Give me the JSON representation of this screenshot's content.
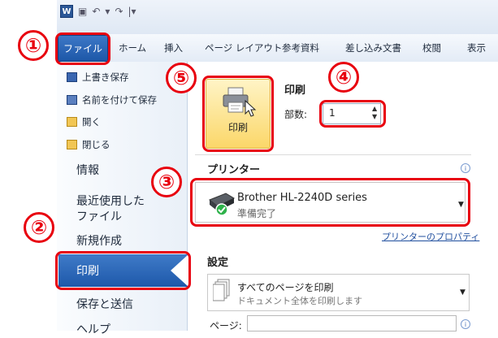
{
  "app": {
    "icon_letter": "W",
    "qat_glyphs": [
      "▣",
      "↶",
      "▾",
      "↷",
      "|▾"
    ]
  },
  "ribbon": {
    "tabs": [
      "ファイル",
      "ホーム",
      "挿入",
      "ページ レイアウト",
      "参考資料",
      "差し込み文書",
      "校閲",
      "表示"
    ]
  },
  "backstage": {
    "commands": [
      "上書き保存",
      "名前を付けて保存",
      "開く",
      "閉じる"
    ],
    "items": [
      "情報",
      "最近使用した\nファイル",
      "新規作成",
      "印刷",
      "保存と送信",
      "ヘルプ"
    ]
  },
  "print": {
    "section_title": "印刷",
    "print_button_label": "印刷",
    "copies_label": "部数:",
    "copies_value": "1",
    "printer_section_title": "プリンター",
    "printer_name": "Brother HL-2240D series",
    "printer_status": "準備完了",
    "printer_properties_link": "プリンターのプロパティ",
    "settings_section_title": "設定",
    "pages_option_main": "すべてのページを印刷",
    "pages_option_sub": "ドキュメント全体を印刷します",
    "pages_label": "ページ:"
  },
  "annotations": [
    "①",
    "②",
    "③",
    "④",
    "⑤"
  ],
  "colors": {
    "annotation_red": "#e8000e",
    "file_tab_blue": "#1d57a8",
    "print_button_gold": "#fbd769"
  }
}
